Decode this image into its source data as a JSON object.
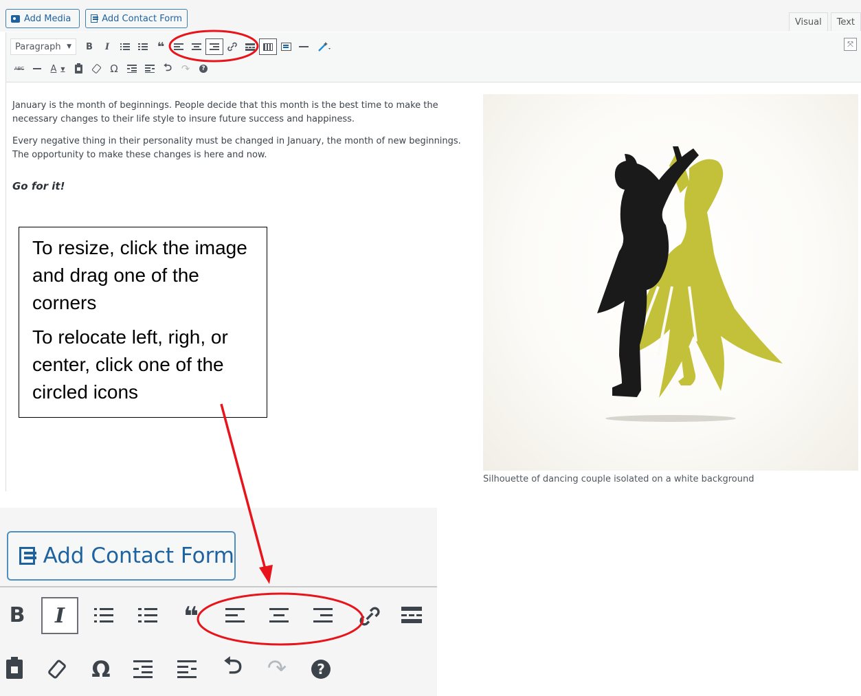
{
  "toolbar": {
    "add_media_label": "Add Media",
    "add_contact_form_label": "Add Contact Form",
    "tab_visual": "Visual",
    "tab_text": "Text",
    "format_select": "Paragraph",
    "bold": "B",
    "italic": "I",
    "blockquote": "❝",
    "omega": "Ω",
    "help": "?",
    "text_color": "A"
  },
  "content": {
    "paragraph_1": "January is the month of beginnings. People decide that this month is the best time to make the necessary changes to their life style to insure future success and happiness.",
    "paragraph_2": "Every negative thing in their personality must be changed in January, the month of new beginnings. The opportunity to make these changes is here and now.",
    "emphasis": "Go for it!",
    "image_caption": "Silhouette of dancing couple isolated on a white background"
  },
  "callout": {
    "line_1": "To resize, click the image and drag one of the corners",
    "line_2": "To relocate left, righ, or center, click one of the circled icons"
  },
  "inset": {
    "add_contact_form_label": "Add Contact Form",
    "bold": "B",
    "italic": "I",
    "omega": "Ω"
  },
  "colors": {
    "accent_blue": "#1e62a0",
    "annotation_red": "#e8141b",
    "dress_color": "#c3c03a",
    "silhouette_black": "#1a1a1a"
  }
}
